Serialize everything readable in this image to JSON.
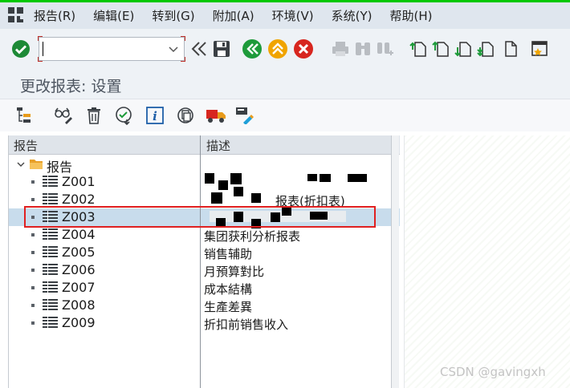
{
  "menu": [
    {
      "id": "report",
      "label": "报告(R)"
    },
    {
      "id": "edit",
      "label": "编辑(E)"
    },
    {
      "id": "goto",
      "label": "转到(G)"
    },
    {
      "id": "extras",
      "label": "附加(A)"
    },
    {
      "id": "environment",
      "label": "环境(V)"
    },
    {
      "id": "system",
      "label": "系统(Y)"
    },
    {
      "id": "help",
      "label": "帮助(H)"
    }
  ],
  "command_field": {
    "value": "",
    "placeholder": ""
  },
  "page_title": "更改报表: 设置",
  "tree": {
    "columns": [
      "报告",
      "描述"
    ],
    "root_label": "报告",
    "rows": [
      {
        "id": "Z001",
        "desc": ""
      },
      {
        "id": "Z002",
        "desc": "报表(折扣表)"
      },
      {
        "id": "Z003",
        "desc": ""
      },
      {
        "id": "Z004",
        "desc": "集团获利分析报表"
      },
      {
        "id": "Z005",
        "desc": "销售辅助"
      },
      {
        "id": "Z006",
        "desc": "月預算對比"
      },
      {
        "id": "Z007",
        "desc": "成本結構"
      },
      {
        "id": "Z008",
        "desc": "生產差異"
      },
      {
        "id": "Z009",
        "desc": "折扣前销售收入"
      }
    ],
    "selected": "Z003"
  },
  "watermark": "CSDN @gavingxh",
  "colors": {
    "accent_green": "#00c800",
    "selection": "#c8dcec",
    "highlight_box": "#e02020"
  }
}
